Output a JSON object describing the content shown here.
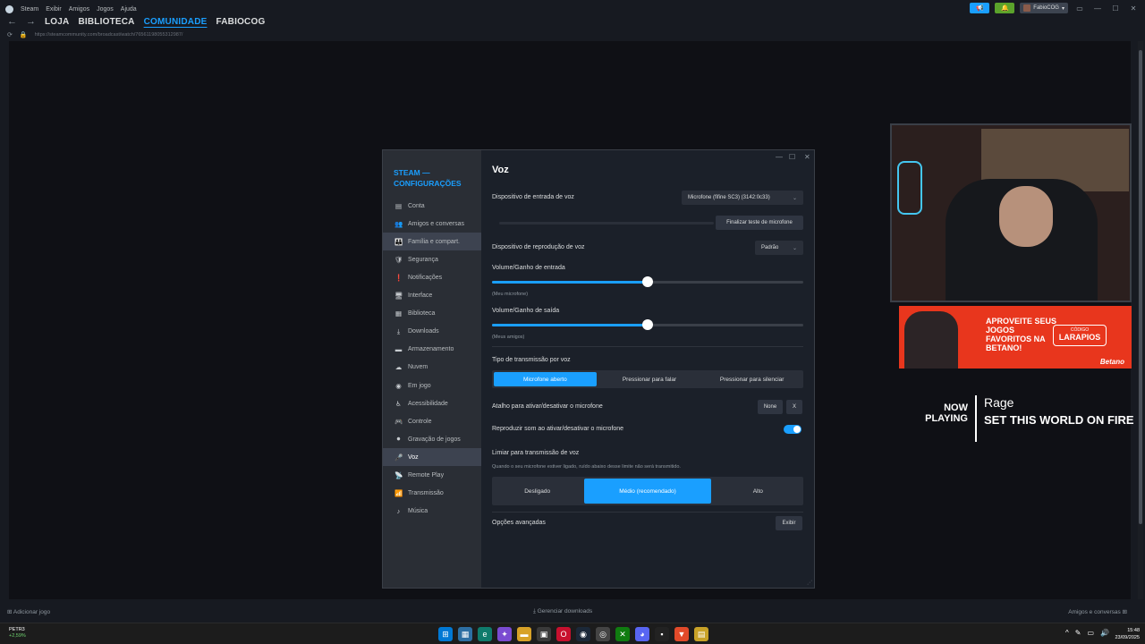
{
  "menu": [
    "Steam",
    "Exibir",
    "Amigos",
    "Jogos",
    "Ajuda"
  ],
  "nav": [
    "LOJA",
    "BIBLIOTECA",
    "COMUNIDADE",
    "FABIOCOG"
  ],
  "url": "https://steamcommunity.com/broadcast/watch/76561198055312987/",
  "user": "FabioCOG",
  "settings": {
    "brand": "STEAM — CONFIGURAÇÕES",
    "sidebar": [
      {
        "label": "Conta",
        "icon": "▤"
      },
      {
        "label": "Amigos e conversas",
        "icon": "👥"
      },
      {
        "label": "Família e compart.",
        "icon": "👪"
      },
      {
        "label": "Segurança",
        "icon": "🛡"
      },
      {
        "label": "Notificações",
        "icon": "❗"
      },
      {
        "label": "Interface",
        "icon": "🖥"
      },
      {
        "label": "Biblioteca",
        "icon": "▦"
      },
      {
        "label": "Downloads",
        "icon": "⤓"
      },
      {
        "label": "Armazenamento",
        "icon": "▬"
      },
      {
        "label": "Nuvem",
        "icon": "☁"
      },
      {
        "label": "Em jogo",
        "icon": "◉"
      },
      {
        "label": "Acessibilidade",
        "icon": "♿"
      },
      {
        "label": "Controle",
        "icon": "🎮"
      },
      {
        "label": "Gravação de jogos",
        "icon": "⏺"
      },
      {
        "label": "Voz",
        "icon": "🎤"
      },
      {
        "label": "Remote Play",
        "icon": "📡"
      },
      {
        "label": "Transmissão",
        "icon": "📶"
      },
      {
        "label": "Música",
        "icon": "♪"
      }
    ],
    "title": "Voz",
    "input_device_label": "Dispositivo de entrada de voz",
    "input_device_value": "Microfone (fifine SC3) (3142:0c33)",
    "mic_test_button": "Finalizar teste de microfone",
    "output_device_label": "Dispositivo de reprodução de voz",
    "output_device_value": "Padrão",
    "input_volume_label": "Volume/Ganho de entrada",
    "input_volume_sub": "(Meu microfone)",
    "input_volume": 0.5,
    "output_volume_label": "Volume/Ganho de saída",
    "output_volume_sub": "(Meus amigos)",
    "output_volume": 0.5,
    "transmission_label": "Tipo de transmissão por voz",
    "transmission_options": [
      "Microfone aberto",
      "Pressionar para falar",
      "Pressionar para silenciar"
    ],
    "hotkey_label": "Atalho para ativar/desativar o microfone",
    "hotkey_value": "None",
    "hotkey_clear": "X",
    "sound_label": "Reproduzir som ao ativar/desativar o microfone",
    "threshold_label": "Limiar para transmissão de voz",
    "threshold_sub": "Quando o seu microfone estiver ligado, ruído abaixo desse limite não será transmitido.",
    "threshold_options": [
      "Desligado",
      "Médio (recomendado)",
      "Alto"
    ],
    "advanced_label": "Opções avançadas",
    "advanced_button": "Exibir"
  },
  "overlay": {
    "ad_text": "APROVEITE SEUS JOGOS FAVORITOS NA BETANO!",
    "ad_code_label": "CÓDIGO",
    "ad_code": "LARAPIOS",
    "ad_brand": "Betano",
    "now_playing": "NOW PLAYING",
    "game": "Rage",
    "song": "SET THIS WORLD ON FIRE"
  },
  "bottombar": {
    "add_game": "Adicionar jogo",
    "downloads": "Gerenciar downloads",
    "friends": "Amigos e conversas"
  },
  "taskbar": {
    "stock": "PETR3",
    "stock_change": "+2,59%",
    "time": "15:48",
    "date": "23/09/2025"
  }
}
